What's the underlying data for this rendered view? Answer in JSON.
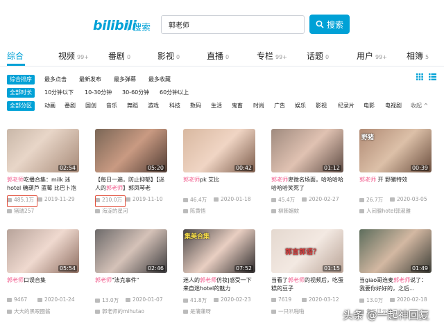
{
  "header": {
    "logo": "bilibili",
    "logo_sub": "搜索",
    "search_value": "郭老师",
    "search_button": "搜索"
  },
  "tabs": [
    {
      "label": "综合",
      "count": ""
    },
    {
      "label": "视频",
      "count": "99+"
    },
    {
      "label": "番剧",
      "count": "0"
    },
    {
      "label": "影视",
      "count": "0"
    },
    {
      "label": "直播",
      "count": "0"
    },
    {
      "label": "专栏",
      "count": "99+"
    },
    {
      "label": "话题",
      "count": "0"
    },
    {
      "label": "用户",
      "count": "99+"
    },
    {
      "label": "相簿",
      "count": "5"
    }
  ],
  "filters": {
    "sort": {
      "label": "综合排序",
      "options": [
        "最多点击",
        "最新发布",
        "最多弹幕",
        "最多收藏"
      ]
    },
    "duration": {
      "label": "全部时长",
      "options": [
        "10分钟以下",
        "10-30分钟",
        "30-60分钟",
        "60分钟以上"
      ]
    },
    "zone": {
      "label": "全部分区",
      "options": [
        "动画",
        "番剧",
        "国创",
        "音乐",
        "舞蹈",
        "游戏",
        "科技",
        "数码",
        "生活",
        "鬼畜",
        "时尚",
        "广告",
        "娱乐",
        "影视",
        "纪录片",
        "电影",
        "电视剧"
      ],
      "fold": "收起 ^"
    }
  },
  "videos": [
    {
      "title_hl": "郭老师",
      "title_rest": "吃播合集：milk 迷hotel 糖葫芦 蓝莓 比巴卜泡",
      "title_hl_pos": "start",
      "duration": "02:54",
      "views": "485.1万",
      "date": "2019-11-29",
      "uploader": "猪瑞257"
    },
    {
      "title_pre": "【每日一遍，防止抑郁】【迷人的",
      "title_hl": "郭老师",
      "title_rest": "】郭凤琴老",
      "duration": "05:20",
      "views": "210.0万",
      "date": "2019-11-10",
      "uploader": "海淀的星河"
    },
    {
      "title_hl": "郭老师",
      "title_rest": "pk 艾比",
      "duration": "00:42",
      "views": "46.4万",
      "date": "2020-01-18",
      "uploader": "陈黄悟"
    },
    {
      "title_hl": "郭老师",
      "title_rest": "卑微名场面，哈哈哈哈哈哈哈笑死了",
      "duration": "01:12",
      "views": "45.4万",
      "date": "2020-02-27",
      "uploader": "柳飾姻欸"
    },
    {
      "title_hl": "郭老师",
      "title_rest": " 开 野猪特效",
      "duration": "00:39",
      "views": "26.7万",
      "date": "2020-03-05",
      "uploader": "人间腺hotel郭淑雅"
    },
    {
      "title_hl": "郭老师",
      "title_rest": "口误合集",
      "duration": "05:54",
      "views": "9467",
      "date": "2020-01-24",
      "uploader": "大大的黑眼圈酱"
    },
    {
      "title_hl": "郭老师",
      "title_rest": "\"法克事件\"",
      "duration": "02:46",
      "views": "13.0万",
      "date": "2020-01-07",
      "uploader": "郭老师的mihutao"
    },
    {
      "title_pre": "迷人的",
      "title_hl": "郭老师",
      "title_rest": "仿妆|感受一下来自迷hotel的魅力",
      "duration": "07:52",
      "views": "41.8万",
      "date": "2020-02-23",
      "uploader": "是蒲蒲呀"
    },
    {
      "title_pre": "当看了",
      "title_hl": "郭老师",
      "title_rest": "的视频后，吃蛋糕的豆子",
      "duration": "01:15",
      "views": "7619",
      "date": "2020-03-12",
      "uploader": "一只叭啪啪"
    },
    {
      "title_pre": "当giao哥连麦",
      "title_hl": "郭老师",
      "title_rest": "说了：我要你好好的，之后...",
      "duration": "01:49",
      "views": "13.0万",
      "date": "2020-02-18",
      "uploader": "贵三世元神"
    }
  ],
  "thumb_overlays": [
    "野猪",
    "集美合集",
    "郭言郭语？"
  ],
  "watermark": "头条 @一起神回复"
}
